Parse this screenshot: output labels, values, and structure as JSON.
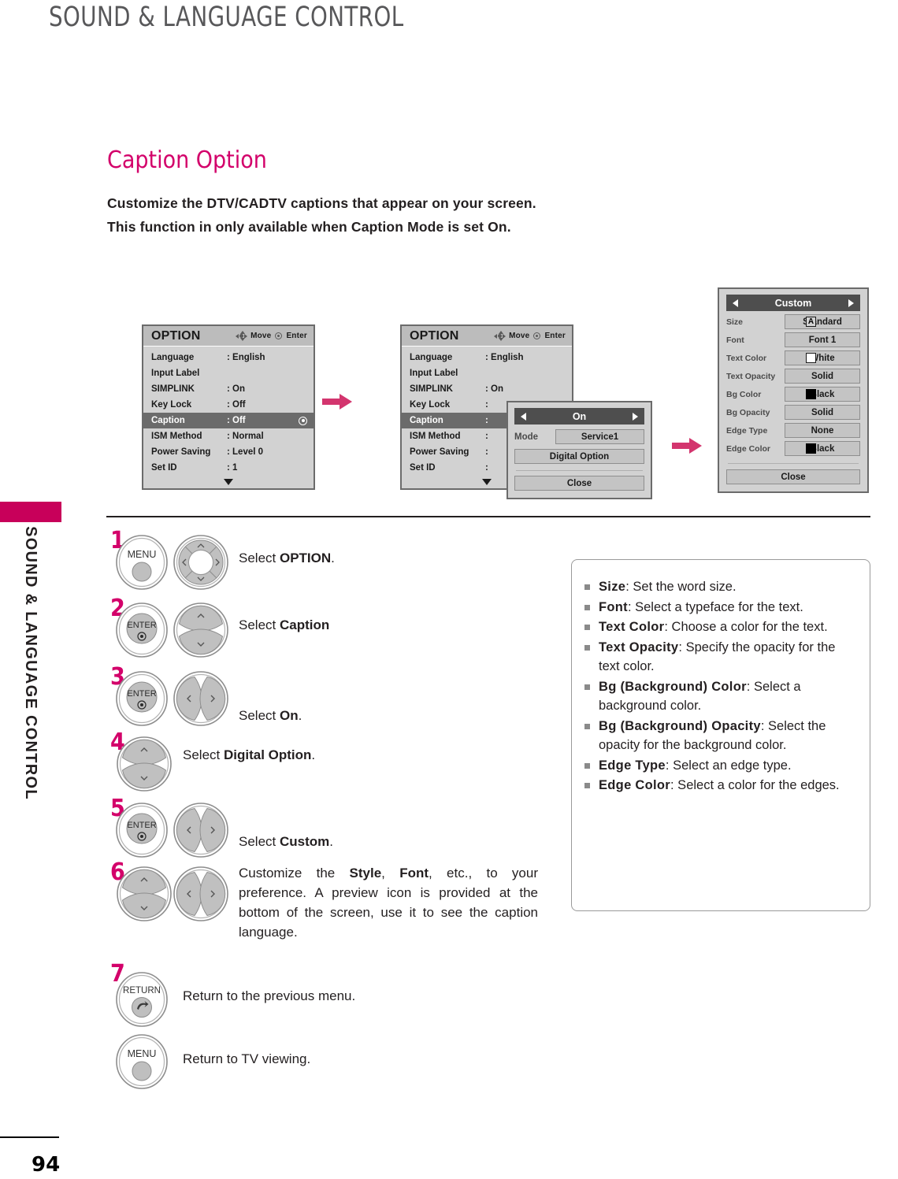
{
  "header": {
    "title": "SOUND & LANGUAGE CONTROL",
    "side_tab_label": "SOUND & LANGUAGE CONTROL"
  },
  "section": {
    "title": "Caption Option",
    "intro_line1": "Customize the DTV/CADTV captions that appear on your screen.",
    "intro_line2_a": "This function in only available when ",
    "intro_line2_b": "Caption",
    "intro_line2_c": " Mode is set ",
    "intro_line2_d": "On",
    "intro_line2_e": "."
  },
  "osd_option_1": {
    "title": "OPTION",
    "hint_move": "Move",
    "hint_enter": "Enter",
    "rows": [
      {
        "key": "Language",
        "value": ": English"
      },
      {
        "key": "Input Label",
        "value": ""
      },
      {
        "key": "SIMPLINK",
        "value": ": On"
      },
      {
        "key": "Key Lock",
        "value": ": Off"
      },
      {
        "key": "Caption",
        "value": ": Off",
        "selected": true
      },
      {
        "key": "ISM Method",
        "value": ": Normal"
      },
      {
        "key": "Power Saving",
        "value": ": Level 0"
      },
      {
        "key": "Set ID",
        "value": ": 1"
      }
    ]
  },
  "osd_option_2": {
    "title": "OPTION",
    "hint_move": "Move",
    "hint_enter": "Enter",
    "rows": [
      {
        "key": "Language",
        "value": ": English"
      },
      {
        "key": "Input Label",
        "value": ""
      },
      {
        "key": "SIMPLINK",
        "value": ": On"
      },
      {
        "key": "Key Lock",
        "value": ":"
      },
      {
        "key": "Caption",
        "value": ":",
        "selected": true
      },
      {
        "key": "ISM Method",
        "value": ":"
      },
      {
        "key": "Power Saving",
        "value": ":"
      },
      {
        "key": "Set ID",
        "value": ":"
      }
    ]
  },
  "popup_caption": {
    "title": "On",
    "mode_label": "Mode",
    "mode_value": "Service1",
    "digital_option": "Digital Option",
    "close": "Close"
  },
  "popup_custom": {
    "title": "Custom",
    "rows": [
      {
        "label": "Size",
        "value": "Standard",
        "swatch": "letter-a"
      },
      {
        "label": "Font",
        "value": "Font 1",
        "swatch": "none"
      },
      {
        "label": "Text Color",
        "value": "White",
        "swatch": "white"
      },
      {
        "label": "Text Opacity",
        "value": "Solid",
        "swatch": "none"
      },
      {
        "label": "Bg Color",
        "value": "Black",
        "swatch": "black"
      },
      {
        "label": "Bg Opacity",
        "value": "Solid",
        "swatch": "none"
      },
      {
        "label": "Edge Type",
        "value": "None",
        "swatch": "none"
      },
      {
        "label": "Edge Color",
        "value": "Black",
        "swatch": "black"
      }
    ],
    "close": "Close"
  },
  "steps": [
    {
      "num": "1",
      "keys": [
        "MENU",
        "dpad"
      ],
      "text_plain": "Select ",
      "text_bold": "OPTION",
      "text_tail": "."
    },
    {
      "num": "2",
      "keys": [
        "ENTER",
        "updown"
      ],
      "text_plain": "Select ",
      "text_bold": "Caption",
      "text_tail": ""
    },
    {
      "num": "3",
      "keys": [
        "ENTER",
        "leftright"
      ],
      "text_plain": "Select ",
      "text_bold": "On",
      "text_tail": "."
    },
    {
      "num": "4",
      "keys": [
        "updown"
      ],
      "text_plain": "Select ",
      "text_bold": "Digital Option",
      "text_tail": "."
    },
    {
      "num": "5",
      "keys": [
        "ENTER",
        "leftright"
      ],
      "text_plain": "Select ",
      "text_bold": "Custom",
      "text_tail": "."
    },
    {
      "num": "6",
      "keys": [
        "updown",
        "leftright"
      ],
      "text_plain": "",
      "text_bold": "",
      "text_tail": ""
    },
    {
      "num": "7",
      "keys": [
        "RETURN"
      ],
      "text_plain": "Return to the previous menu.",
      "text_bold": "",
      "text_tail": ""
    }
  ],
  "step6": {
    "a": "Customize the ",
    "b1": "Style",
    "c": ", ",
    "b2": "Font",
    "d": ", etc., to your preference. A preview icon is provided at the bottom of the screen, use it to see the caption language."
  },
  "step_menu_last": {
    "key_label": "MENU",
    "text": "Return to TV viewing."
  },
  "key_labels": {
    "menu": "MENU",
    "enter": "ENTER",
    "return": "RETURN"
  },
  "info_bullets": [
    {
      "term": "Size",
      "desc": ": Set the word size."
    },
    {
      "term": "Font",
      "desc": ": Select a typeface for the text."
    },
    {
      "term": "Text Color",
      "desc": ": Choose a color for the text."
    },
    {
      "term": "Text Opacity",
      "desc": ": Specify the opacity for the text color."
    },
    {
      "term": "Bg (Background) Color",
      "desc": ": Select a background color."
    },
    {
      "term": "Bg (Background) Opacity",
      "desc": ": Select the opacity for the background color."
    },
    {
      "term": "Edge Type",
      "desc": ": Select an edge type."
    },
    {
      "term": "Edge Color",
      "desc": ": Select a color for the edges."
    }
  ],
  "footer": {
    "page_number": "94"
  },
  "colors": {
    "accent_pink": "#d3006a",
    "tab_pink": "#c8005a",
    "header_gray": "#58585a",
    "osd_bg": "#d2d2d2",
    "osd_border": "#6b6b6b",
    "osd_selected": "#6b6b6b",
    "popup_title_bg": "#4e4e4e",
    "button_gray": "#c4c4c4"
  }
}
